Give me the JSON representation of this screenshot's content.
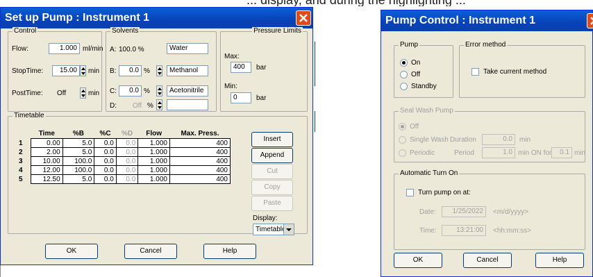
{
  "colors": {
    "title_bar": "#0842b8",
    "dialog_bg": "#ece9d8",
    "close_button": "#e24a1a"
  },
  "top_fragment": "... display, and during the highlighting ...",
  "setup": {
    "title": "Set up Pump : Instrument 1",
    "control": {
      "label": "Control",
      "flow_label": "Flow:",
      "flow_value": "1.000",
      "flow_unit": "ml/min",
      "stoptime_label": "StopTime:",
      "stoptime_value": "15.00",
      "stoptime_unit": "min",
      "posttime_label": "PostTime:",
      "posttime_value": "Off",
      "posttime_unit": "min"
    },
    "solvents": {
      "label": "Solvents",
      "a_label": "A:",
      "a_percent": "100.0 %",
      "a_name": "Water",
      "b_label": "B:",
      "b_percent": "0.0",
      "b_unit": "%",
      "b_name": "Methanol",
      "c_label": "C:",
      "c_percent": "0.0",
      "c_unit": "%",
      "c_name": "Acetonitrile",
      "d_label": "D:",
      "d_percent": "Off",
      "d_unit": "%",
      "d_name": ""
    },
    "pressure": {
      "label": "Pressure Limits",
      "max_label": "Max:",
      "max_value": "400",
      "max_unit": "bar",
      "min_label": "Min:",
      "min_value": "0",
      "min_unit": "bar"
    },
    "timetable": {
      "label": "Timetable",
      "headers": [
        "Time",
        "%B",
        "%C",
        "%D",
        "Flow",
        "Max. Press."
      ],
      "rows": [
        {
          "n": "1",
          "time": "0.00",
          "b": "5.0",
          "c": "0.0",
          "d": "0.0",
          "flow": "1.000",
          "maxp": "400"
        },
        {
          "n": "2",
          "time": "2.00",
          "b": "5.0",
          "c": "0.0",
          "d": "0.0",
          "flow": "1.000",
          "maxp": "400"
        },
        {
          "n": "3",
          "time": "10.00",
          "b": "100.0",
          "c": "0.0",
          "d": "0.0",
          "flow": "1.000",
          "maxp": "400"
        },
        {
          "n": "4",
          "time": "12.00",
          "b": "100.0",
          "c": "0.0",
          "d": "0.0",
          "flow": "1.000",
          "maxp": "400"
        },
        {
          "n": "5",
          "time": "12.50",
          "b": "5.0",
          "c": "0.0",
          "d": "0.0",
          "flow": "1.000",
          "maxp": "400"
        }
      ],
      "insert": "Insert",
      "append": "Append",
      "cut": "Cut",
      "copy": "Copy",
      "paste": "Paste",
      "display_label": "Display:",
      "display_value": "Timetable"
    },
    "ok": "OK",
    "cancel": "Cancel",
    "help": "Help"
  },
  "control": {
    "title": "Pump Control : Instrument 1",
    "pump": {
      "label": "Pump",
      "on": "On",
      "off": "Off",
      "standby": "Standby",
      "selected": "On"
    },
    "error_method": {
      "label": "Error method",
      "take_current": "Take current method"
    },
    "seal_wash": {
      "label": "Seal Wash Pump",
      "off": "Off",
      "single": "Single Wash",
      "duration_label": "Duration",
      "duration_value": "0.0",
      "duration_unit": "min",
      "periodic": "Periodic",
      "period_label": "Period",
      "period_value": "1.0",
      "min_on_for": "min ON for",
      "on_value": "0.1",
      "on_unit": "min"
    },
    "auto_turn_on": {
      "label": "Automatic Turn On",
      "checkbox": "Turn pump on at:",
      "date_label": "Date:",
      "date_value": "1/25/2022",
      "date_hint": "<m/d/yyyy>",
      "time_label": "Time:",
      "time_value": "13:21:00",
      "time_hint": "<hh:mm:ss>"
    },
    "ok": "OK",
    "cancel": "Cancel",
    "help": "Help"
  }
}
